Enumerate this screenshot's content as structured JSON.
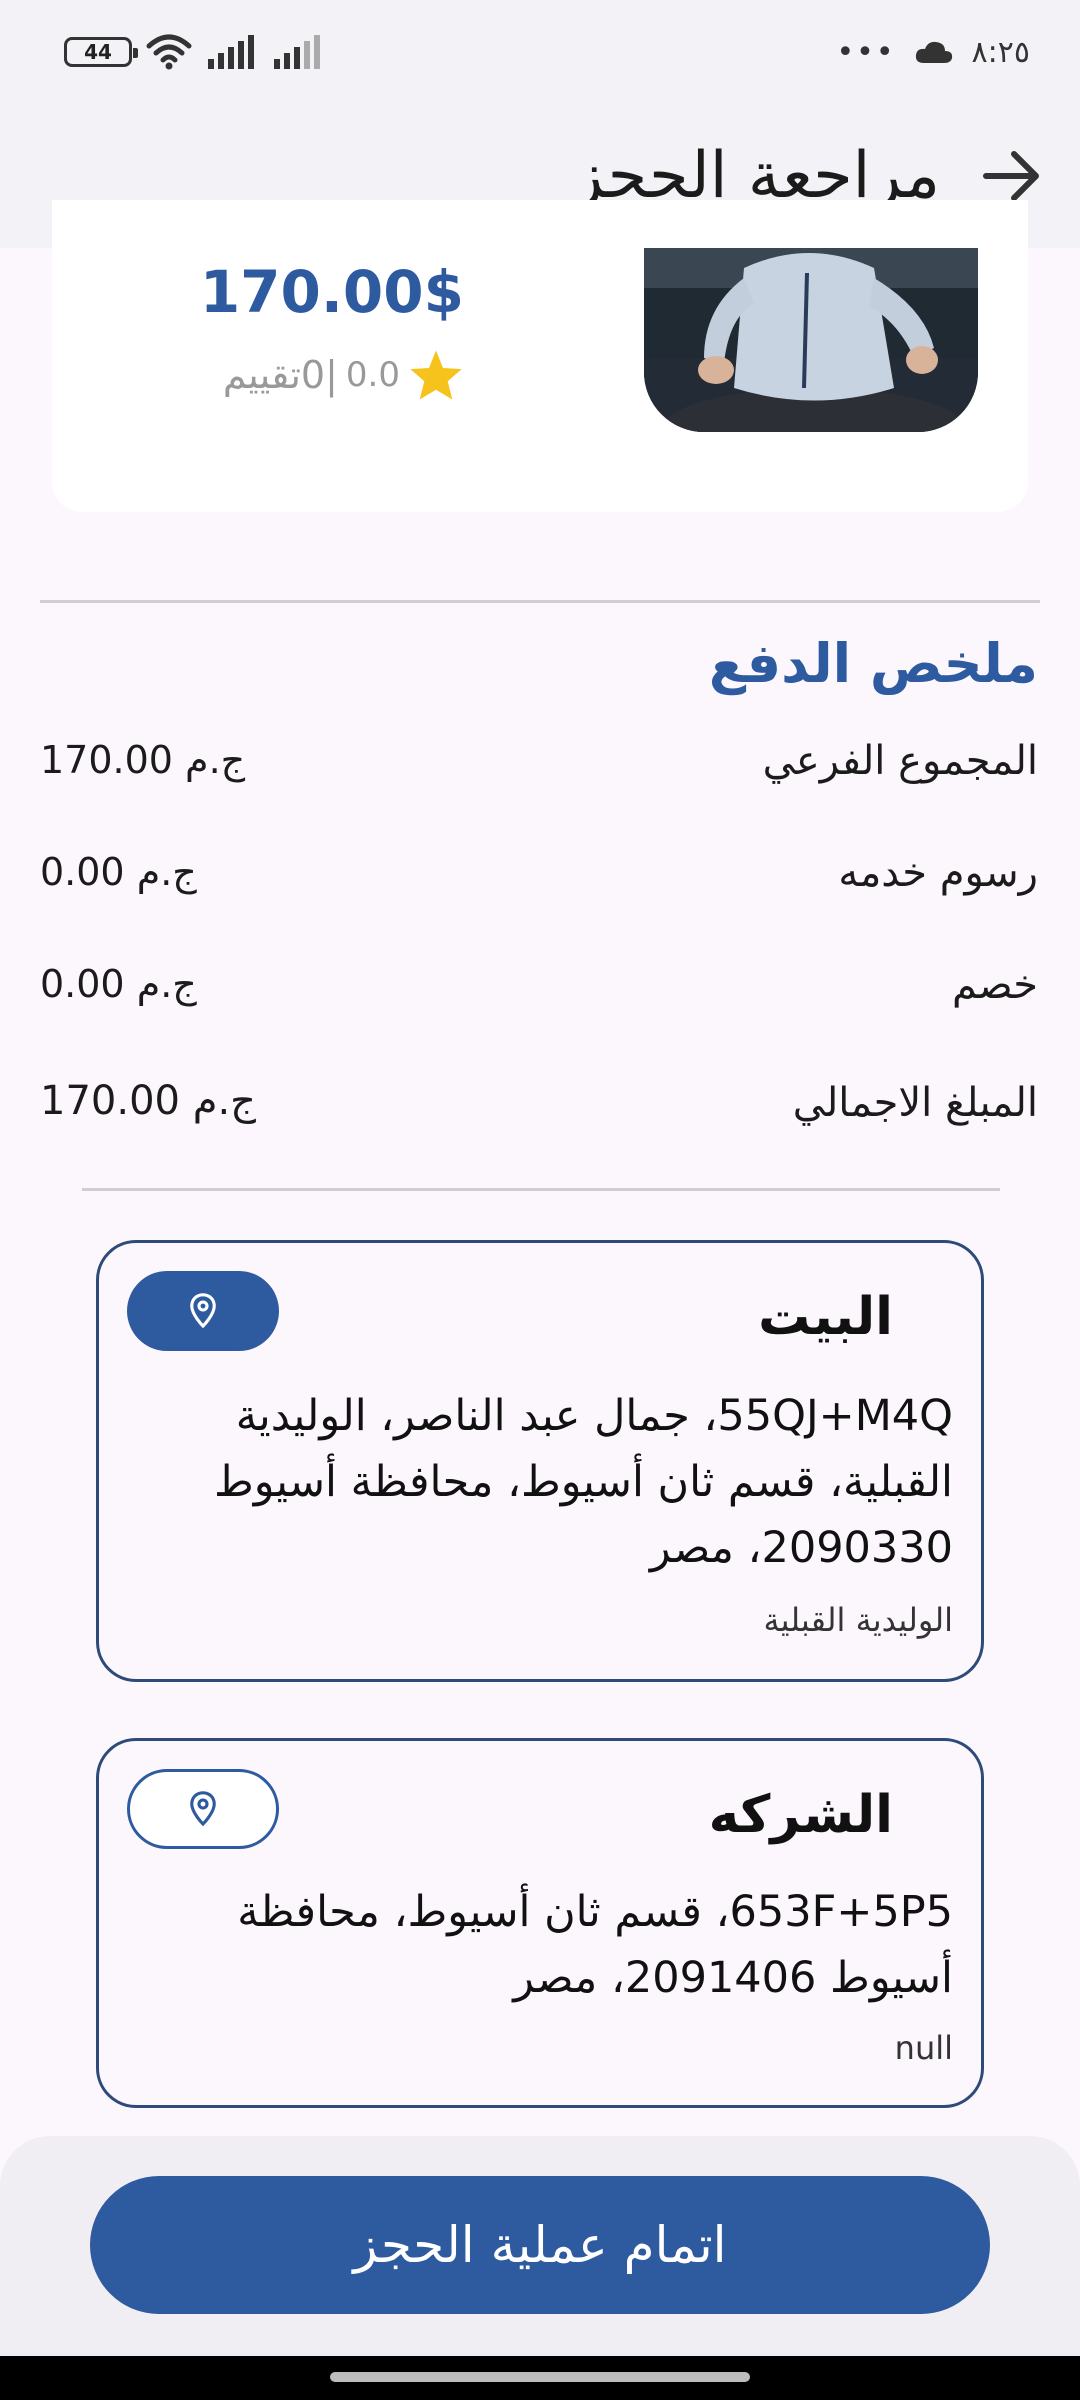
{
  "status_bar": {
    "battery": "44",
    "time": "٨:٢٥",
    "dots": "•••"
  },
  "app_bar": {
    "title": "مراجعة الحجز",
    "back_icon": "arrow-right-icon"
  },
  "provider": {
    "price": "170.00$",
    "rating_value": "0.0",
    "rating_label": "|0تقييم",
    "star_color": "#f6c21c"
  },
  "payment_summary": {
    "title": "ملخص الدفع",
    "rows": [
      {
        "label": "المجموع الفرعي",
        "value": "170.00 ج.م"
      },
      {
        "label": "رسوم خدمه",
        "value": "0.00 ج.م"
      },
      {
        "label": "خصم",
        "value": "0.00 ج.م"
      },
      {
        "label": "المبلغ الاجمالي",
        "value": "170.00 ج.م"
      }
    ]
  },
  "addresses": [
    {
      "title": "البيت",
      "address": "55QJ+M4Q، جمال عبد الناصر، الوليدية القبلية، قسم ثان أسيوط، محافظة أسيوط 2090330، مصر",
      "sub": "الوليدية القبلية",
      "selected": true
    },
    {
      "title": "الشركه",
      "address": "653F+5P5، قسم ثان أسيوط، محافظة أسيوط 2091406، مصر",
      "sub": "null",
      "selected": false
    }
  ],
  "confirm_button": "اتمام عملية الحجز",
  "colors": {
    "primary": "#2e5aa0",
    "background": "#fcf7fd",
    "bar": "#f3f2f6"
  }
}
